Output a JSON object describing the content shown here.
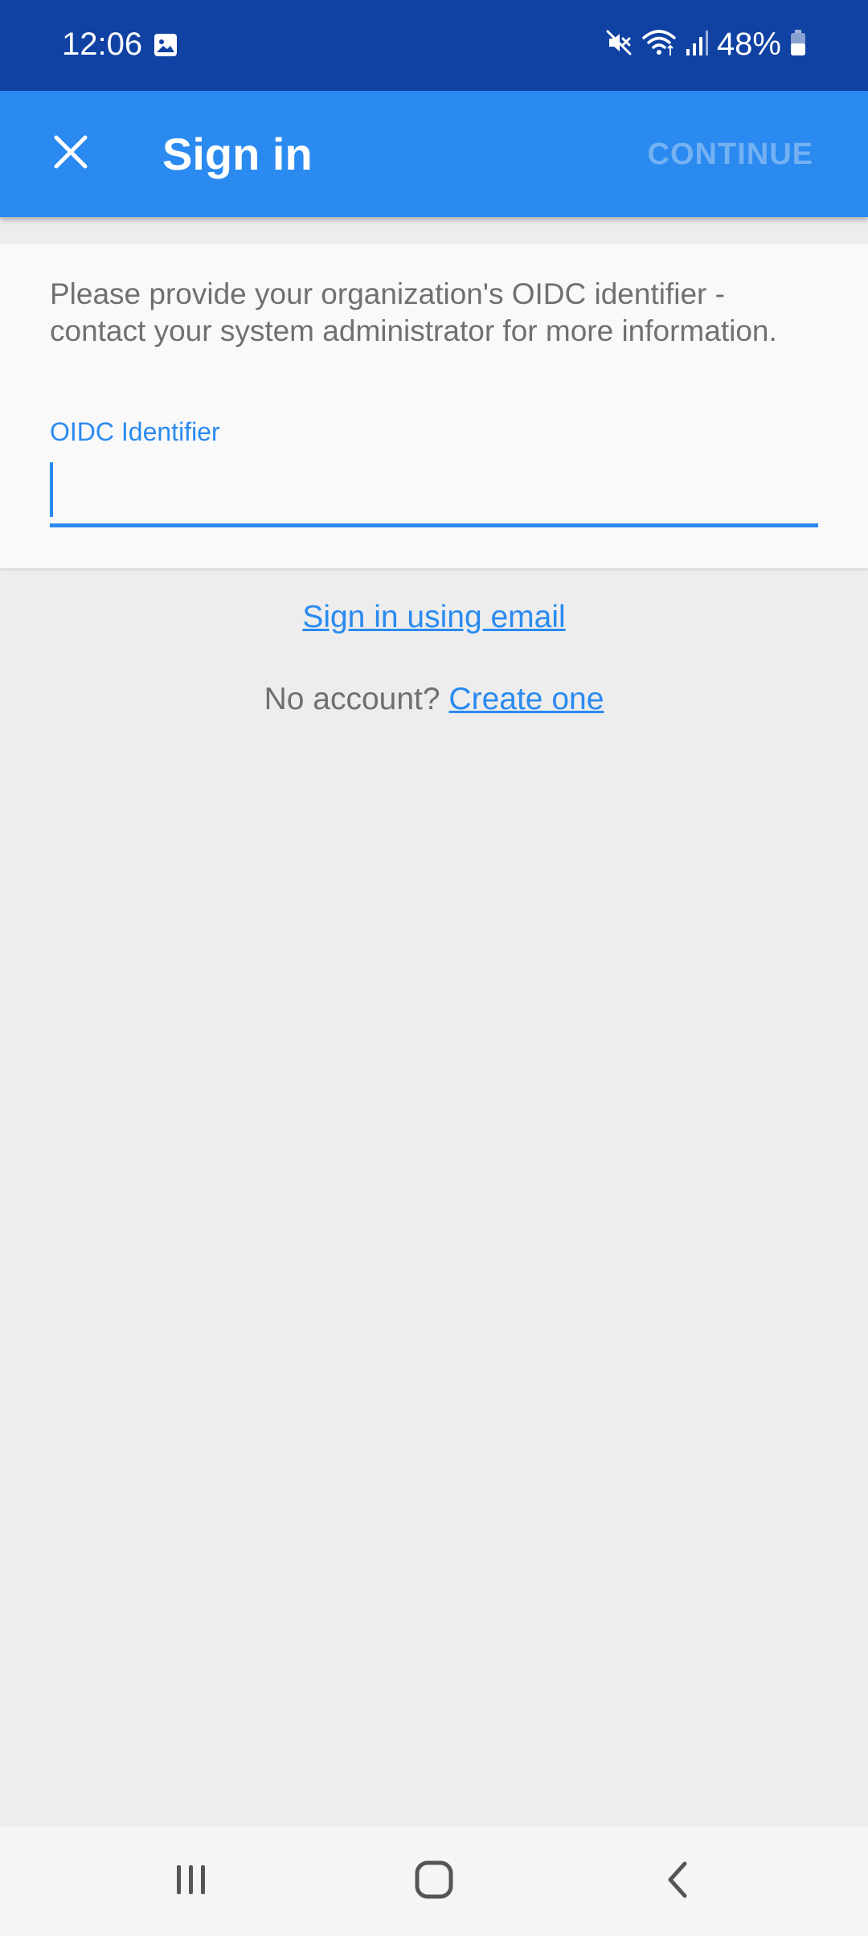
{
  "status_bar": {
    "time": "12:06",
    "battery": "48%",
    "icons": [
      "gallery-icon",
      "mute-icon",
      "wifi-icon",
      "signal-icon",
      "battery-icon"
    ]
  },
  "app_bar": {
    "close_icon": "close-icon",
    "title": "Sign in",
    "continue_label": "CONTINUE"
  },
  "card": {
    "description": "Please provide your organization's OIDC identifier - contact your system administrator for more information.",
    "field_label": "OIDC Identifier",
    "field_value": ""
  },
  "links": {
    "email_signin": "Sign in using email",
    "no_account_prefix": "No account?",
    "create_one": "Create one"
  },
  "nav_bar": {
    "icons": [
      "recent-apps-icon",
      "home-icon",
      "back-icon"
    ]
  },
  "colors": {
    "status_bar": "#1042a3",
    "accent": "#2a8af0",
    "continue_disabled": "#74b1f2",
    "background": "#ededed",
    "text_secondary": "#707070"
  }
}
